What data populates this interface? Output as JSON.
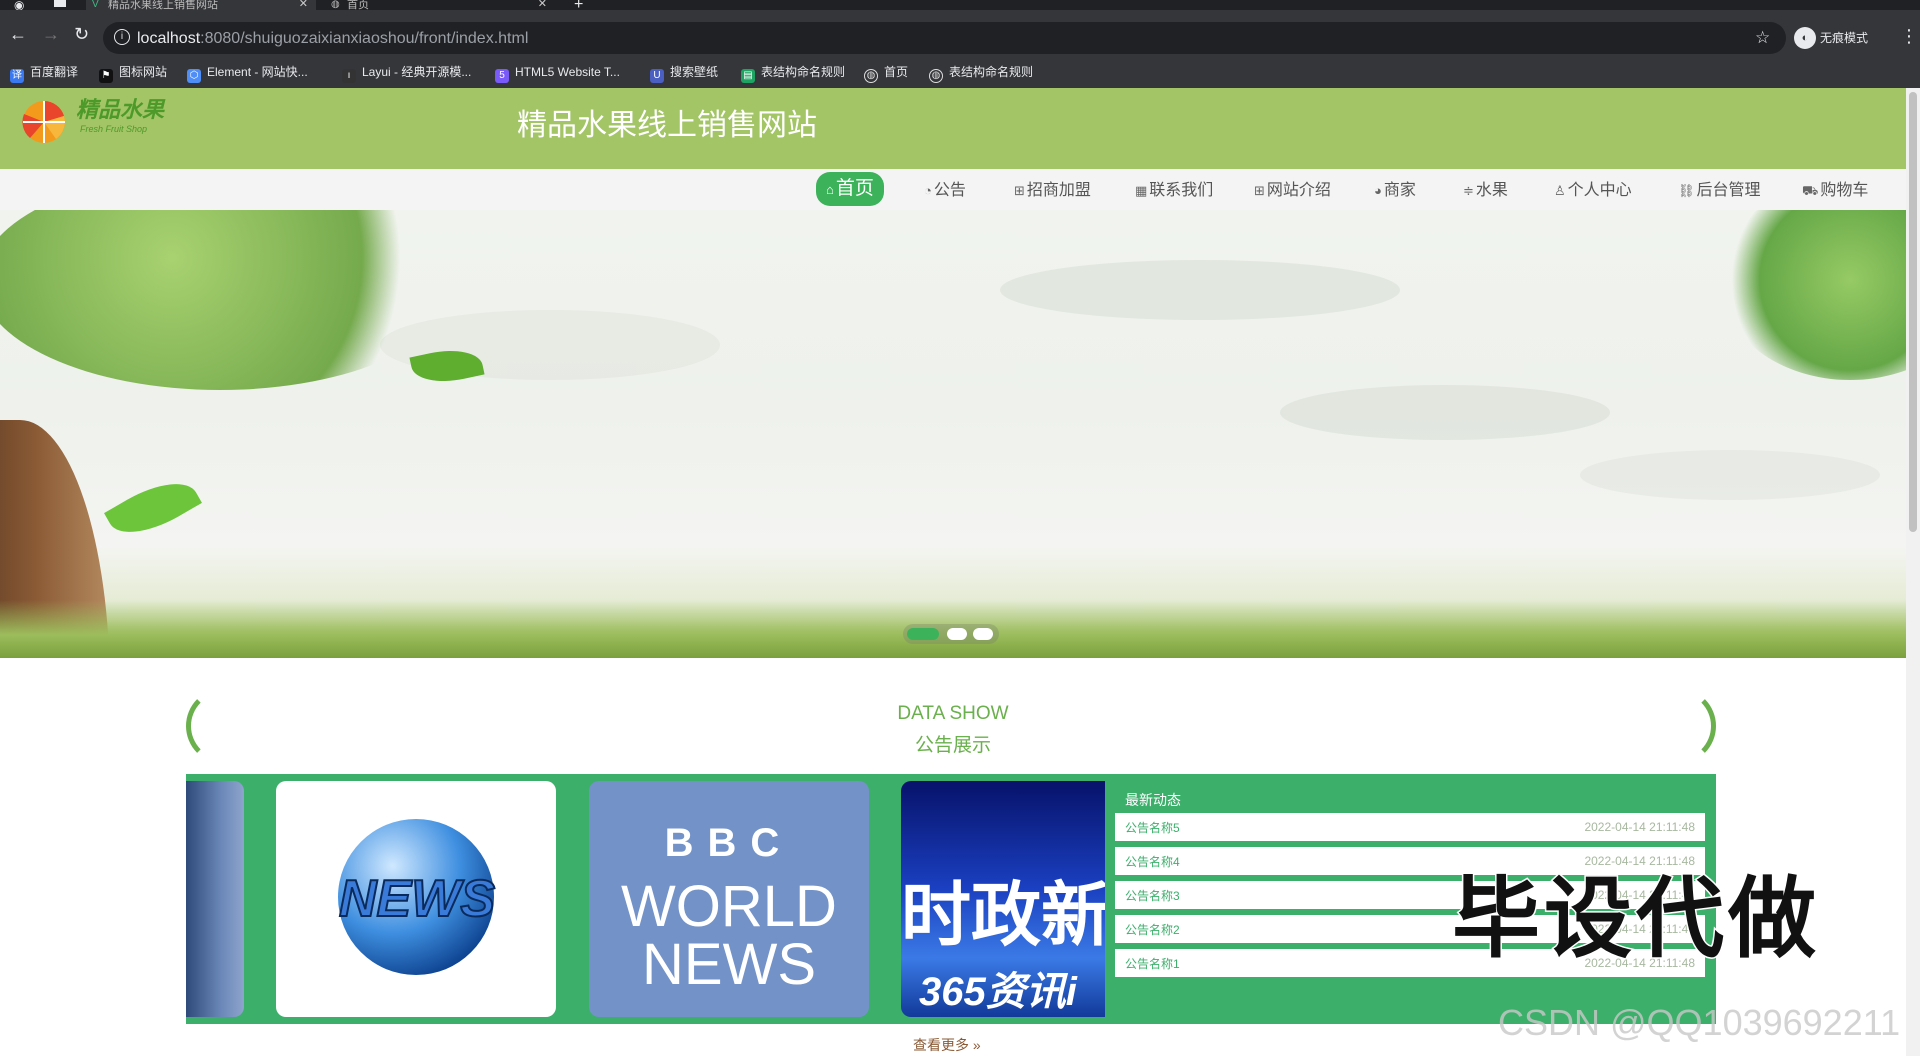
{
  "browser": {
    "tabs": [
      {
        "title": "精品水果线上销售网站"
      },
      {
        "title": "首页"
      }
    ],
    "new_tab": "+",
    "url_host": "localhost",
    "url_path": ":8080/shuiguozaixianxiaoshou/front/index.html",
    "incognito_label": "无痕模式",
    "bookmarks": [
      {
        "label": "百度翻译",
        "color": "#3a79f0"
      },
      {
        "label": "图标网站",
        "color": "#111111"
      },
      {
        "label": "Element - 网站快...",
        "color": "#4f8ef7"
      },
      {
        "label": "Layui - 经典开源模...",
        "color": "#333333"
      },
      {
        "label": "HTML5 Website T...",
        "color": "#7a5af8"
      },
      {
        "label": "搜索壁纸",
        "color": "#4a5fc1"
      },
      {
        "label": "表结构命名规则",
        "color": "#1ea362"
      },
      {
        "label": "首页",
        "color": "#dddddd"
      },
      {
        "label": "表结构命名规则",
        "color": "#dddddd"
      }
    ]
  },
  "site": {
    "logo_text": "精品水果",
    "logo_sub": "Fresh Fruit Shop",
    "title": "精品水果线上销售网站"
  },
  "nav": [
    {
      "label": "首页",
      "icon": "home-icon",
      "glyph": "⌂",
      "active": true
    },
    {
      "label": "公告",
      "icon": "gauge-icon",
      "glyph": "◔"
    },
    {
      "label": "招商加盟",
      "icon": "gift-icon",
      "glyph": "⊞"
    },
    {
      "label": "联系我们",
      "icon": "grid-icon",
      "glyph": "▦"
    },
    {
      "label": "网站介绍",
      "icon": "apps-icon",
      "glyph": "⊞"
    },
    {
      "label": "商家",
      "icon": "palette-icon",
      "glyph": "◕"
    },
    {
      "label": "水果",
      "icon": "sliders-icon",
      "glyph": "≑"
    },
    {
      "label": "个人中心",
      "icon": "user-icon",
      "glyph": "♙"
    },
    {
      "label": "后台管理",
      "icon": "link-icon",
      "glyph": "⛓"
    },
    {
      "label": "购物车",
      "icon": "cart-icon",
      "glyph": "⛟"
    }
  ],
  "datashow": {
    "title_en": "DATA SHOW",
    "title_cn": "公告展示"
  },
  "cards": {
    "globe_text": "NEWS",
    "bbc_line1": "BBC",
    "bbc_line2": "WORLD",
    "bbc_line3": "NEWS",
    "politics_text": "时政新",
    "politics_sub": "365资讯i"
  },
  "news": {
    "heading": "最新动态",
    "items": [
      {
        "title": "公告名称5",
        "date": "2022-04-14 21:11:48"
      },
      {
        "title": "公告名称4",
        "date": "2022-04-14 21:11:48"
      },
      {
        "title": "公告名称3",
        "date": "2022-04-14 21:11:48"
      },
      {
        "title": "公告名称2",
        "date": "2022-04-14 21:11:48"
      },
      {
        "title": "公告名称1",
        "date": "2022-04-14 21:11:48"
      }
    ]
  },
  "more_label": "查看更多",
  "overlay_text": "毕设代做",
  "watermark": "CSDN @QQ1039692211"
}
